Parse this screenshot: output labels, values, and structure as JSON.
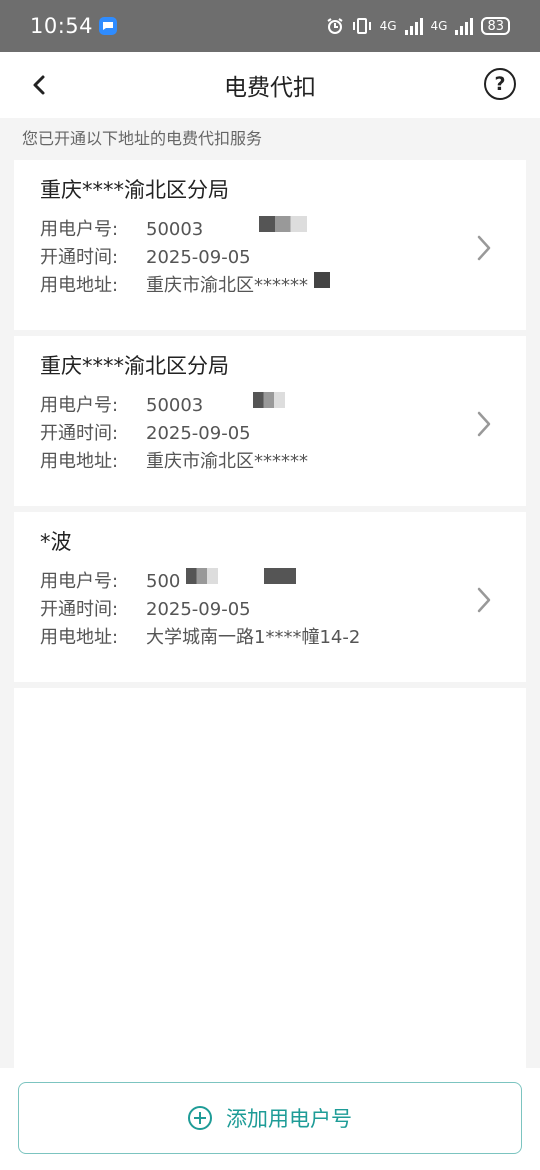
{
  "status": {
    "time": "10:54",
    "net1": "4G",
    "net2": "4G",
    "battery": "83"
  },
  "header": {
    "title": "电费代扣"
  },
  "subtitle": "您已开通以下地址的电费代扣服务",
  "labels": {
    "account": "用电户号:",
    "open_time": "开通时间:",
    "address": "用电地址:"
  },
  "accounts": [
    {
      "name": "重庆****渝北区分局",
      "account_no": "50003",
      "open_time": "2025-09-05",
      "address": "重庆市渝北区******"
    },
    {
      "name": "重庆****渝北区分局",
      "account_no": "50003",
      "open_time": "2025-09-05",
      "address": "重庆市渝北区******"
    },
    {
      "name": "*波",
      "account_no": "500",
      "open_time": "2025-09-05",
      "address": "大学城南一路1****幢14-2"
    }
  ],
  "add_button": {
    "label": "添加用电户号"
  },
  "colors": {
    "accent": "#1e9c97",
    "status_bar": "#6e6e6e"
  }
}
